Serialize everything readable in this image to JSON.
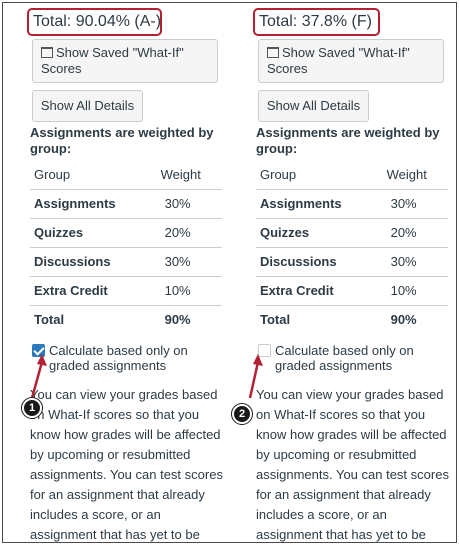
{
  "panels": [
    {
      "total": "Total: 90.04% (A-)",
      "whatif_label": "Show Saved \"What-If\" Scores",
      "details_label": "Show All Details",
      "weighted_text": "Assignments are weighted by group:",
      "table": {
        "headers": [
          "Group",
          "Weight"
        ],
        "rows": [
          [
            "Assignments",
            "30%"
          ],
          [
            "Quizzes",
            "20%"
          ],
          [
            "Discussions",
            "30%"
          ],
          [
            "Extra Credit",
            "10%"
          ],
          [
            "Total",
            "90%"
          ]
        ]
      },
      "calc_checked": true,
      "calc_label": "Calculate based only on graded assignments",
      "info": "You can view your grades based on What-If scores so that you know how grades will be affected by upcoming or resubmitted assignments. You can test scores for an assignment that already includes a score, or an assignment that has yet to be graded.",
      "marker": "1"
    },
    {
      "total": "Total: 37.8% (F)",
      "whatif_label": "Show Saved \"What-If\" Scores",
      "details_label": "Show All Details",
      "weighted_text": "Assignments are weighted by group:",
      "table": {
        "headers": [
          "Group",
          "Weight"
        ],
        "rows": [
          [
            "Assignments",
            "30%"
          ],
          [
            "Quizzes",
            "20%"
          ],
          [
            "Discussions",
            "30%"
          ],
          [
            "Extra Credit",
            "10%"
          ],
          [
            "Total",
            "90%"
          ]
        ]
      },
      "calc_checked": false,
      "calc_label": "Calculate based only on graded assignments",
      "info": "You can view your grades based on What-If scores so that you know how grades will be affected by upcoming or resubmitted assignments. You can test scores for an assignment that already includes a score, or an assignment that has yet to be graded.",
      "marker": "2"
    }
  ],
  "colors": {
    "highlight": "#b22234",
    "checkbox_on": "#2b7abc",
    "text": "#2d3b45"
  }
}
